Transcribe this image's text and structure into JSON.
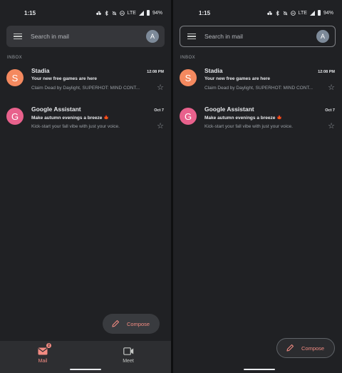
{
  "status": {
    "time": "1:15",
    "network": "LTE",
    "battery": "94%"
  },
  "search": {
    "placeholder": "Search in mail",
    "avatar_initial": "A"
  },
  "section_label": "INBOX",
  "emails": [
    {
      "initial": "S",
      "avatar_color": "#f4895f",
      "sender": "Stadia",
      "date": "12:08 PM",
      "subject": "Your new free games are here",
      "snippet": "Claim Dead by Daylight, SUPERHOT: MIND CONT..."
    },
    {
      "initial": "G",
      "avatar_color": "#e8618c",
      "sender": "Google Assistant",
      "date": "Oct 7",
      "subject": "Make autumn evenings a breeze",
      "subject_icon": "🍁",
      "snippet": "Kick-start your fall vibe with just your voice."
    }
  ],
  "compose": {
    "label": "Compose",
    "icon": "pencil-icon"
  },
  "bottom_nav": {
    "mail_label": "Mail",
    "mail_badge": "2",
    "meet_label": "Meet"
  },
  "colors": {
    "background": "#202124",
    "accent": "#f28b82"
  }
}
